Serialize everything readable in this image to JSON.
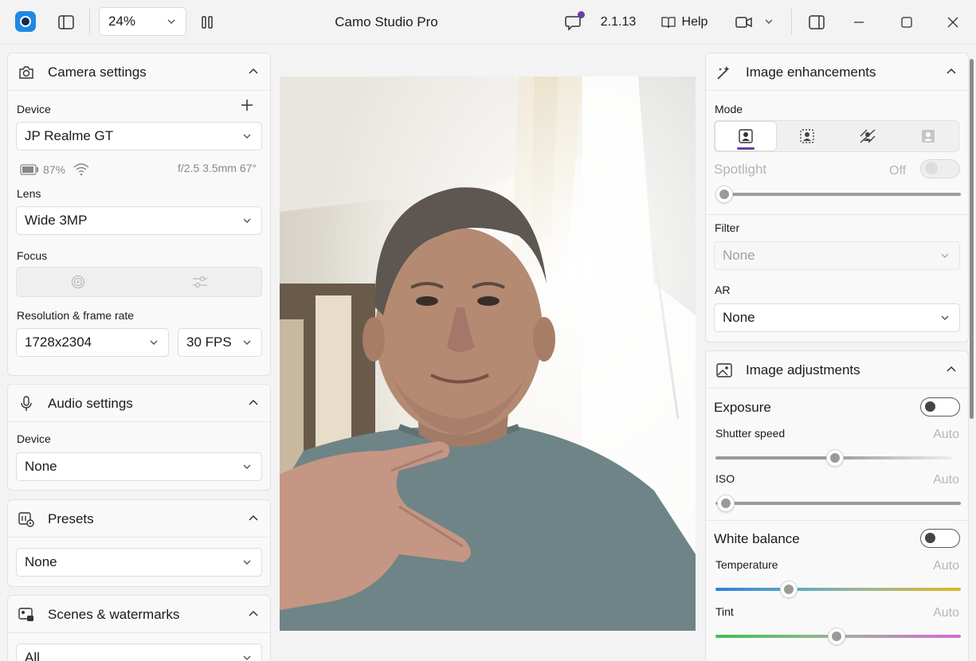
{
  "titlebar": {
    "app_title": "Camo Studio Pro",
    "zoom_value": "24%",
    "version": "2.1.13",
    "help_label": "Help",
    "notification_color": "#6a3fa0"
  },
  "camera_settings": {
    "title": "Camera settings",
    "device_label": "Device",
    "device_value": "JP Realme GT",
    "battery": "87%",
    "lens_info": "f/2.5 3.5mm 67°",
    "lens_label": "Lens",
    "lens_value": "Wide 3MP",
    "focus_label": "Focus",
    "resolution_label": "Resolution & frame rate",
    "resolution_value": "1728x2304",
    "fps_value": "30 FPS"
  },
  "audio_settings": {
    "title": "Audio settings",
    "device_label": "Device",
    "device_value": "None"
  },
  "presets": {
    "title": "Presets",
    "value": "None"
  },
  "scenes": {
    "title": "Scenes & watermarks",
    "value": "All"
  },
  "image_enhancements": {
    "title": "Image enhancements",
    "mode_label": "Mode",
    "spotlight_label": "Spotlight",
    "spotlight_state": "Off",
    "filter_label": "Filter",
    "filter_value": "None",
    "ar_label": "AR",
    "ar_value": "None"
  },
  "image_adjustments": {
    "title": "Image adjustments",
    "exposure_label": "Exposure",
    "shutter_label": "Shutter speed",
    "shutter_value": "Auto",
    "iso_label": "ISO",
    "iso_value": "Auto",
    "white_balance_label": "White balance",
    "temperature_label": "Temperature",
    "temperature_value": "Auto",
    "tint_label": "Tint",
    "tint_value": "Auto"
  },
  "colors": {
    "accent": "#6a3fa0",
    "logo": "#1e88e5"
  }
}
